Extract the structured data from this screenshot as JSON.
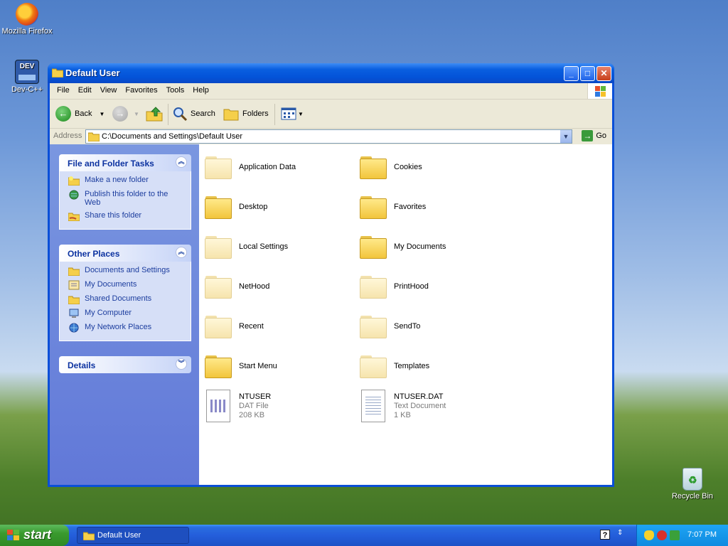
{
  "desktop": {
    "icons": [
      {
        "label": "Mozilla Firefox"
      },
      {
        "label": "Dev-C++",
        "badge": "DEV"
      },
      {
        "label": "Recycle Bin"
      }
    ]
  },
  "window": {
    "title": "Default User",
    "menu": [
      "File",
      "Edit",
      "View",
      "Favorites",
      "Tools",
      "Help"
    ],
    "toolbar": {
      "back_label": "Back",
      "search_label": "Search",
      "folders_label": "Folders"
    },
    "address": {
      "label": "Address",
      "value": "C:\\Documents and Settings\\Default User",
      "go_label": "Go"
    },
    "left_pane": {
      "file_tasks": {
        "title": "File and Folder Tasks",
        "links": [
          "Make a new folder",
          "Publish this folder to the Web",
          "Share this folder"
        ]
      },
      "other_places": {
        "title": "Other Places",
        "links": [
          "Documents and Settings",
          "My Documents",
          "Shared Documents",
          "My Computer",
          "My Network Places"
        ]
      },
      "details": {
        "title": "Details"
      }
    },
    "items": [
      {
        "name": "Application Data",
        "type": "folder",
        "faded": true
      },
      {
        "name": "Cookies",
        "type": "folder",
        "faded": false
      },
      {
        "name": "Desktop",
        "type": "folder",
        "faded": false
      },
      {
        "name": "Favorites",
        "type": "folder",
        "faded": false
      },
      {
        "name": "Local Settings",
        "type": "folder",
        "faded": true
      },
      {
        "name": "My Documents",
        "type": "folder",
        "faded": false
      },
      {
        "name": "NetHood",
        "type": "folder",
        "faded": true
      },
      {
        "name": "PrintHood",
        "type": "folder",
        "faded": true
      },
      {
        "name": "Recent",
        "type": "folder",
        "faded": true
      },
      {
        "name": "SendTo",
        "type": "folder",
        "faded": true
      },
      {
        "name": "Start Menu",
        "type": "folder",
        "faded": false
      },
      {
        "name": "Templates",
        "type": "folder",
        "faded": true
      },
      {
        "name": "NTUSER",
        "type": "dat",
        "kind": "DAT File",
        "size": "208 KB"
      },
      {
        "name": "NTUSER.DAT",
        "type": "txt",
        "kind": "Text Document",
        "size": "1 KB"
      }
    ]
  },
  "taskbar": {
    "start_label": "start",
    "task_button": "Default User",
    "clock": "7:07 PM",
    "help_glyph": "?"
  },
  "colors": {
    "titlebar": "#0353d8",
    "left_pane": "#6d87dc",
    "link_text": "#1c3d9e",
    "start_button": "#3a9a2e",
    "taskbar": "#245edb"
  }
}
